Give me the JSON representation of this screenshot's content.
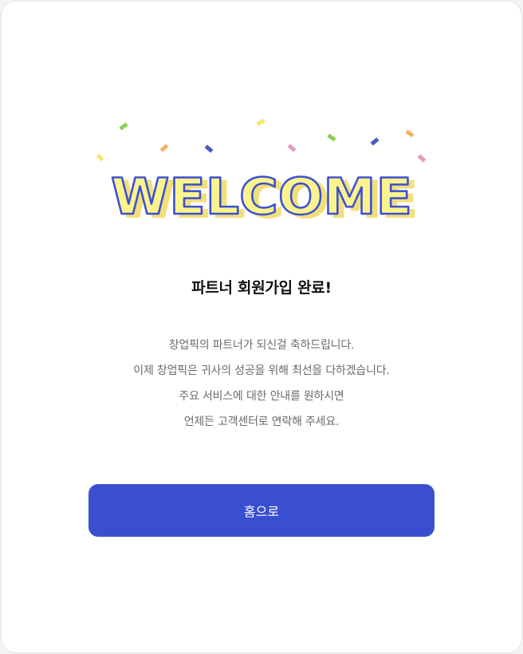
{
  "welcome_text": "WELCOME",
  "title": "파트너 회원가입 완료!",
  "messages": [
    "창업픽의 파트너가 되신걸 축하드립니다.",
    "이제 창업픽은 귀사의 성공을 위해 최선을 다하겠습니다.",
    "주요 서비스에 대한 안내를 원하시면",
    "언제든 고객센터로 연락해 주세요."
  ],
  "home_button": "홈으로",
  "colors": {
    "accent": "#3a4fd0",
    "welcome_fill": "#fbf48c",
    "welcome_outline": "#3b4fd4",
    "confetti": [
      "#f7e66a",
      "#8ccf4e",
      "#f2b35c",
      "#4a5bbd",
      "#e59bbf"
    ]
  },
  "icons": [
    "confetti-icon"
  ]
}
